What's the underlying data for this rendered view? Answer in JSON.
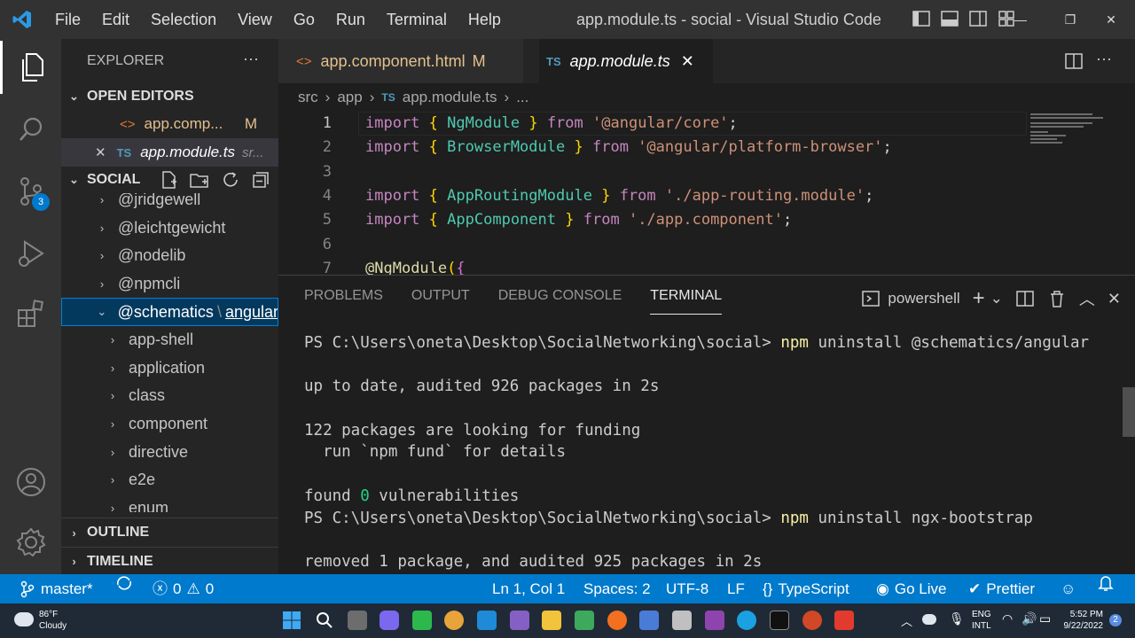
{
  "titlebar": {
    "menu": [
      "File",
      "Edit",
      "Selection",
      "View",
      "Go",
      "Run",
      "Terminal",
      "Help"
    ],
    "window_title": "app.module.ts - social - Visual Studio Code",
    "controls": [
      "—",
      "❐",
      "✕"
    ]
  },
  "activity_bar": {
    "items": [
      "explorer-icon",
      "search-icon",
      "source-control-icon",
      "run-debug-icon",
      "extensions-icon",
      "account-icon",
      "manage-gear-icon"
    ],
    "source_control_badge": "3"
  },
  "sidebar": {
    "title": "EXPLORER",
    "more": "···",
    "open_editors": {
      "header": "OPEN EDITORS",
      "items": [
        {
          "icon": "<>",
          "name": "app.comp...",
          "status": "M"
        },
        {
          "icon": "TS",
          "name": "app.module.ts",
          "path": "sr..."
        }
      ]
    },
    "folder": {
      "header": "SOCIAL",
      "items": [
        {
          "label": "@jridgewell",
          "level": 0
        },
        {
          "label": "@leichtgewicht",
          "level": 0
        },
        {
          "label": "@nodelib",
          "level": 0
        },
        {
          "label": "@npmcli",
          "level": 0
        },
        {
          "label": "@schematics",
          "sep": "\\",
          "label2": "angular",
          "level": 0,
          "expanded": true
        },
        {
          "label": "app-shell",
          "level": 1
        },
        {
          "label": "application",
          "level": 1
        },
        {
          "label": "class",
          "level": 1
        },
        {
          "label": "component",
          "level": 1
        },
        {
          "label": "directive",
          "level": 1
        },
        {
          "label": "e2e",
          "level": 1
        },
        {
          "label": "enum",
          "level": 1
        }
      ]
    },
    "outline": "OUTLINE",
    "timeline": "TIMELINE"
  },
  "editor": {
    "tabs": [
      {
        "icon": "<>",
        "label": "app.component.html",
        "status": "M"
      },
      {
        "icon": "TS",
        "label": "app.module.ts",
        "close": "✕"
      }
    ],
    "breadcrumb": [
      "src",
      "app",
      "app.module.ts",
      "..."
    ],
    "breadcrumb_icon": "TS",
    "lines": [
      {
        "n": "1",
        "parts": [
          [
            "kw",
            "import"
          ],
          [
            "pl",
            " "
          ],
          [
            "br",
            "{"
          ],
          [
            "pl",
            " "
          ],
          [
            "ty",
            "NgModule"
          ],
          [
            "pl",
            " "
          ],
          [
            "br",
            "}"
          ],
          [
            "pl",
            " "
          ],
          [
            "kw",
            "from"
          ],
          [
            "pl",
            " "
          ],
          [
            "st",
            "'@angular/core'"
          ],
          [
            "pl",
            ";"
          ]
        ]
      },
      {
        "n": "2",
        "parts": [
          [
            "kw",
            "import"
          ],
          [
            "pl",
            " "
          ],
          [
            "br",
            "{"
          ],
          [
            "pl",
            " "
          ],
          [
            "ty",
            "BrowserModule"
          ],
          [
            "pl",
            " "
          ],
          [
            "br",
            "}"
          ],
          [
            "pl",
            " "
          ],
          [
            "kw",
            "from"
          ],
          [
            "pl",
            " "
          ],
          [
            "st",
            "'@angular/platform-browser'"
          ],
          [
            "pl",
            ";"
          ]
        ]
      },
      {
        "n": "3",
        "parts": []
      },
      {
        "n": "4",
        "parts": [
          [
            "kw",
            "import"
          ],
          [
            "pl",
            " "
          ],
          [
            "br",
            "{"
          ],
          [
            "pl",
            " "
          ],
          [
            "ty",
            "AppRoutingModule"
          ],
          [
            "pl",
            " "
          ],
          [
            "br",
            "}"
          ],
          [
            "pl",
            " "
          ],
          [
            "kw",
            "from"
          ],
          [
            "pl",
            " "
          ],
          [
            "st",
            "'./app-routing.module'"
          ],
          [
            "pl",
            ";"
          ]
        ]
      },
      {
        "n": "5",
        "parts": [
          [
            "kw",
            "import"
          ],
          [
            "pl",
            " "
          ],
          [
            "br",
            "{"
          ],
          [
            "pl",
            " "
          ],
          [
            "ty",
            "AppComponent"
          ],
          [
            "pl",
            " "
          ],
          [
            "br",
            "}"
          ],
          [
            "pl",
            " "
          ],
          [
            "kw",
            "from"
          ],
          [
            "pl",
            " "
          ],
          [
            "st",
            "'./app.component'"
          ],
          [
            "pl",
            ";"
          ]
        ]
      },
      {
        "n": "6",
        "parts": []
      },
      {
        "n": "7",
        "parts": [
          [
            "dec",
            "@"
          ],
          [
            "dec",
            "NgModule"
          ],
          [
            "br",
            "("
          ],
          [
            "br2",
            "{"
          ]
        ]
      }
    ]
  },
  "panel": {
    "tabs": [
      "PROBLEMS",
      "OUTPUT",
      "DEBUG CONSOLE",
      "TERMINAL"
    ],
    "active_tab": "TERMINAL",
    "shell": "powershell",
    "terminal_lines": [
      {
        "prompt": "PS C:\\Users\\oneta\\Desktop\\SocialNetworking\\social> ",
        "cmd": "npm",
        "rest": " uninstall @schematics/angular"
      },
      {
        "text": ""
      },
      {
        "text": "up to date, audited 926 packages in 2s"
      },
      {
        "text": ""
      },
      {
        "text": "122 packages are looking for funding"
      },
      {
        "text": "  run `npm fund` for details"
      },
      {
        "text": ""
      },
      {
        "pre": "found ",
        "zero": "0",
        "post": " vulnerabilities"
      },
      {
        "prompt": "PS C:\\Users\\oneta\\Desktop\\SocialNetworking\\social> ",
        "cmd": "npm",
        "rest": " uninstall ngx-bootstrap"
      },
      {
        "text": ""
      },
      {
        "text": "removed 1 package, and audited 925 packages in 2s"
      }
    ]
  },
  "status_bar": {
    "branch": "master*",
    "errors": "0",
    "warnings": "0",
    "position": "Ln 1, Col 1",
    "spaces": "Spaces: 2",
    "encoding": "UTF-8",
    "eol": "LF",
    "language": "TypeScript",
    "golive": "Go Live",
    "prettier": "Prettier"
  },
  "taskbar": {
    "weather_temp": "86°F",
    "weather_desc": "Cloudy",
    "lang1": "ENG",
    "lang2": "INTL",
    "time": "5:52 PM",
    "date": "9/22/2022",
    "notif": "2"
  }
}
